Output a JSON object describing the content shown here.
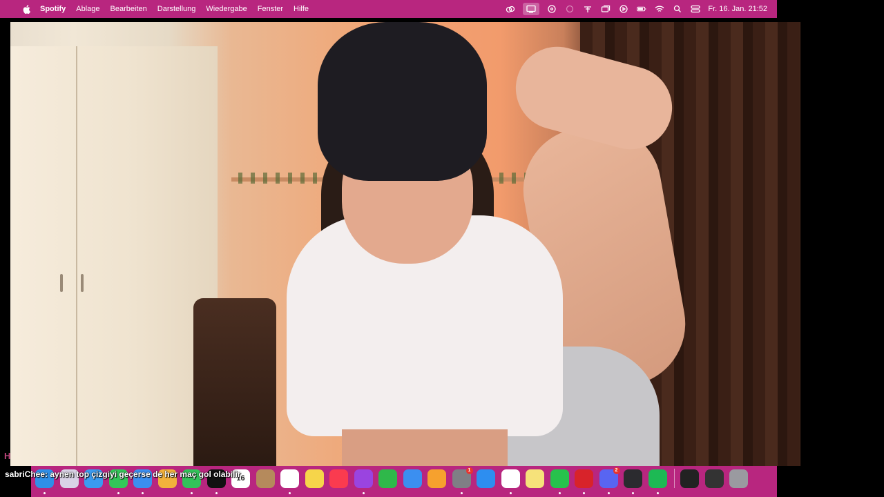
{
  "menubar": {
    "apple_icon": "apple-icon",
    "items": [
      "Spotify",
      "Ablage",
      "Bearbeiten",
      "Darstellung",
      "Wiedergabe",
      "Fenster",
      "Hilfe"
    ],
    "status_icons": [
      "creative-cloud-icon",
      "screen-mirroring-icon",
      "obs-icon",
      "recording-icon",
      "airdrop-icon",
      "window-icon",
      "play-icon",
      "battery-icon",
      "wifi-icon",
      "search-icon",
      "control-center-icon"
    ],
    "clock": "Fr. 16. Jan.  21:52"
  },
  "chat": {
    "user": "sabriChee",
    "message": ": aynen top çizgiyi geçerse de her maç gol olabilir",
    "prefix_letter": "H"
  },
  "dock": {
    "apps": [
      {
        "name": "finder-icon",
        "color": "#2f8fe8"
      },
      {
        "name": "launchpad-icon",
        "color": "#d9d2e6"
      },
      {
        "name": "safari-icon",
        "color": "#3a9bf0"
      },
      {
        "name": "messages-icon",
        "color": "#33c759"
      },
      {
        "name": "mail-icon",
        "color": "#3b8ff0"
      },
      {
        "name": "photos-icon",
        "color": "#f2b13c"
      },
      {
        "name": "facetime-icon",
        "color": "#32c35a"
      },
      {
        "name": "tv-icon",
        "color": "#111111"
      },
      {
        "name": "calendar-icon",
        "color": "#ffffff"
      },
      {
        "name": "contacts-icon",
        "color": "#b58a5c"
      },
      {
        "name": "reminders-icon",
        "color": "#ffffff"
      },
      {
        "name": "notes-icon",
        "color": "#f6d54a"
      },
      {
        "name": "music-icon",
        "color": "#fa3b4f"
      },
      {
        "name": "podcasts-icon",
        "color": "#9a44e0"
      },
      {
        "name": "numbers-icon",
        "color": "#2fb84a"
      },
      {
        "name": "keynote-icon",
        "color": "#3b8ff0"
      },
      {
        "name": "pages-icon",
        "color": "#f6a12e"
      },
      {
        "name": "system-settings-icon",
        "color": "#7f7f85"
      },
      {
        "name": "app-store-icon",
        "color": "#2d8ef0"
      },
      {
        "name": "chrome-icon",
        "color": "#ffffff"
      },
      {
        "name": "stickies-icon",
        "color": "#f6e27a"
      },
      {
        "name": "whatsapp-icon",
        "color": "#27c24c"
      },
      {
        "name": "uhh-app-icon",
        "color": "#d8232a"
      },
      {
        "name": "discord-icon",
        "color": "#5865f2"
      },
      {
        "name": "obs-studio-icon",
        "color": "#2b2b2f"
      },
      {
        "name": "spotify-icon",
        "color": "#1db954"
      }
    ],
    "extras": [
      {
        "name": "screen-thumbnail-icon",
        "color": "#222222"
      },
      {
        "name": "window-thumbnail-icon",
        "color": "#333333"
      },
      {
        "name": "trash-icon",
        "color": "#9a9aa0"
      }
    ],
    "calendar_day": "16",
    "system_settings_badge": "1",
    "discord_badge": "2"
  }
}
